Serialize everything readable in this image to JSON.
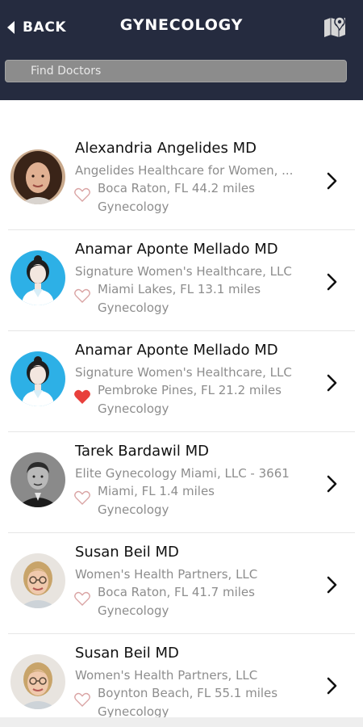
{
  "header": {
    "back_label": "BACK",
    "title": "GYNECOLOGY",
    "background": "#252b3f",
    "search_placeholder": "Find Doctors"
  },
  "doctors": [
    {
      "name": "Alexandria Angelides MD",
      "practice": "Angelides Healthcare for Women, ...",
      "location": "Boca Raton, FL 44.2 miles",
      "specialty": "Gynecology",
      "favorited": false,
      "avatar": "photo-woman-curly-hair-icon"
    },
    {
      "name": "Anamar Aponte Mellado MD",
      "practice": "Signature Women's Healthcare, LLC",
      "location": "Miami Lakes, FL 13.1 miles",
      "specialty": "Gynecology",
      "favorited": false,
      "avatar": "default-female-avatar-icon"
    },
    {
      "name": "Anamar Aponte Mellado MD",
      "practice": "Signature Women's Healthcare, LLC",
      "location": "Pembroke Pines, FL 21.2 miles",
      "specialty": "Gynecology",
      "favorited": true,
      "avatar": "default-female-avatar-icon"
    },
    {
      "name": "Tarek Bardawil MD",
      "practice": "Elite Gynecology Miami, LLC - 3661",
      "location": "Miami, FL 1.4 miles",
      "specialty": "Gynecology",
      "favorited": false,
      "avatar": "photo-man-bw-icon"
    },
    {
      "name": "Susan Beil MD",
      "practice": "Women's Health Partners, LLC",
      "location": "Boca Raton, FL 41.7 miles",
      "specialty": "Gynecology",
      "favorited": false,
      "avatar": "photo-woman-glasses-icon"
    },
    {
      "name": "Susan Beil MD",
      "practice": "Women's Health Partners, LLC",
      "location": "Boynton Beach, FL 55.1 miles",
      "specialty": "Gynecology",
      "favorited": false,
      "avatar": "photo-woman-glasses-icon"
    }
  ],
  "colors": {
    "heart_favorite": "#e8403c",
    "heart_outline": "#d9a3a3",
    "default_avatar_bg": "#2db0e6"
  }
}
